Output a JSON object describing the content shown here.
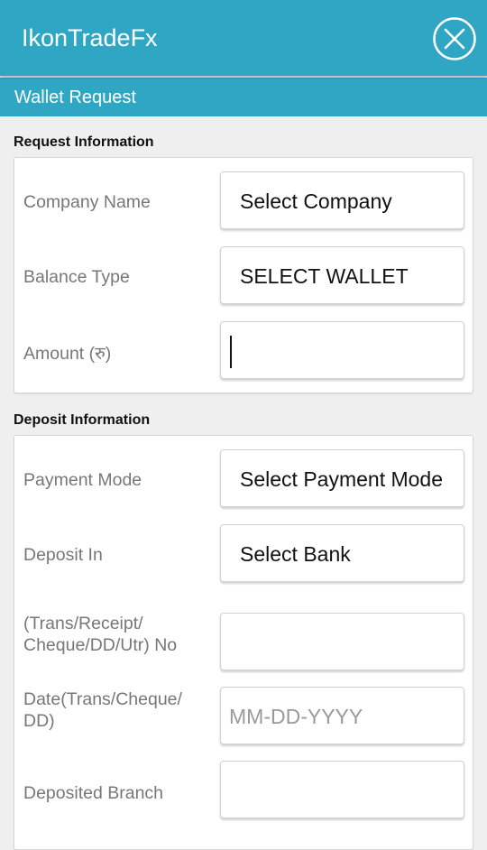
{
  "app": {
    "title": "IkonTradeFx",
    "close_icon": "close-circle-icon"
  },
  "subheader": {
    "title": "Wallet Request"
  },
  "request_info": {
    "heading": "Request Information",
    "company": {
      "label": "Company Name",
      "value": "Select Company"
    },
    "balance": {
      "label": "Balance Type",
      "value": "SELECT WALLET"
    },
    "amount": {
      "label": "Amount  (रु)",
      "value": ""
    }
  },
  "deposit_info": {
    "heading": "Deposit Information",
    "payment_mode": {
      "label": "Payment Mode",
      "value": "Select Payment Mode"
    },
    "deposit_in": {
      "label": "Deposit In",
      "value": "Select Bank"
    },
    "trans_no": {
      "label": "(Trans/Receipt/\nCheque/DD/Utr) No",
      "value": ""
    },
    "date": {
      "label": "Date(Trans/Cheque/\nDD)",
      "placeholder": "MM-DD-YYYY"
    },
    "branch": {
      "label": "Deposited Branch",
      "value": ""
    }
  },
  "colors": {
    "accent": "#2fa7c4",
    "background": "#efefef",
    "label": "#777777"
  }
}
